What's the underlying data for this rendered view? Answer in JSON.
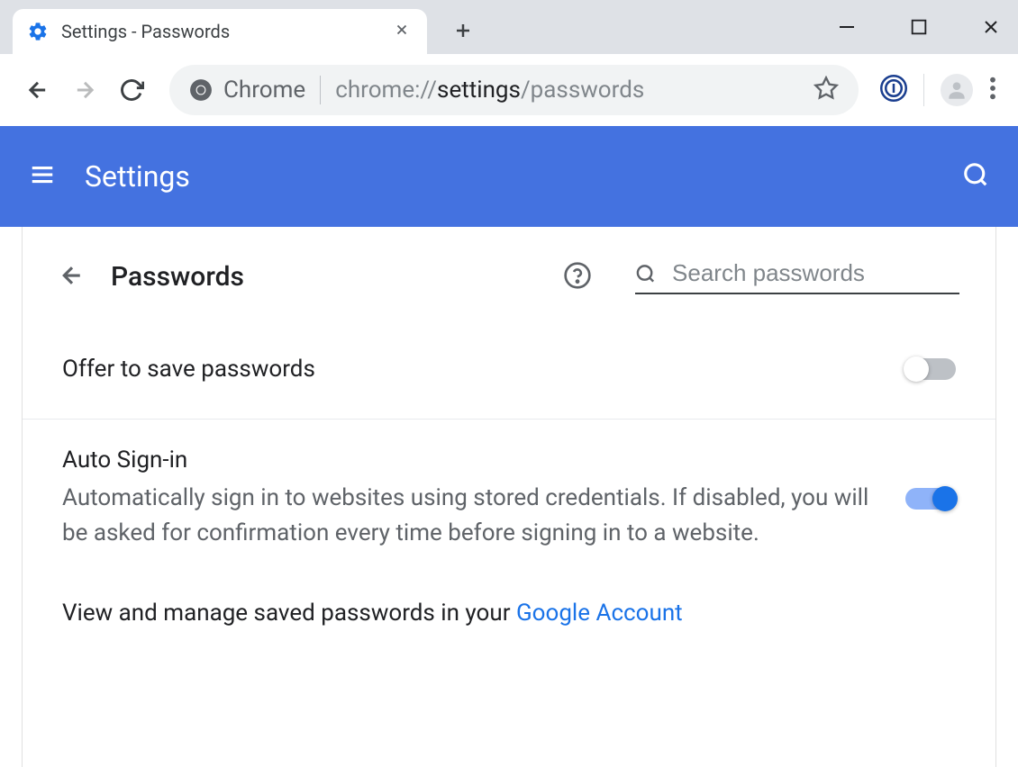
{
  "browser": {
    "tab_title": "Settings - Passwords",
    "omnibox_chip": "Chrome",
    "url_prefix": "chrome://",
    "url_strong": "settings",
    "url_suffix": "/passwords"
  },
  "header": {
    "title": "Settings"
  },
  "page": {
    "title": "Passwords",
    "search_placeholder": "Search passwords"
  },
  "settings": {
    "offer_label": "Offer to save passwords",
    "auto_label": "Auto Sign-in",
    "auto_desc": "Automatically sign in to websites using stored credentials. If disabled, you will be asked for confirmation every time before signing in to a website."
  },
  "footer": {
    "prefix": "View and manage saved passwords in your ",
    "link_text": "Google Account"
  }
}
